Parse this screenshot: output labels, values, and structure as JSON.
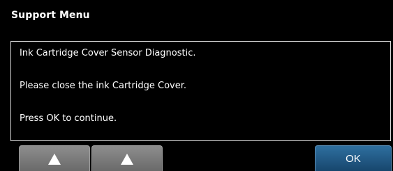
{
  "menu": {
    "title": "Support Menu"
  },
  "message": {
    "lines": [
      "Ink Cartridge Cover Sensor Diagnostic.",
      "Please close the ink Cartridge Cover.",
      "Press OK to continue."
    ]
  },
  "buttons": {
    "up_1_icon": "up-triangle-icon",
    "up_2_icon": "up-triangle-icon",
    "ok_label": "OK"
  },
  "colors": {
    "background": "#000000",
    "ok_button": "#1f5a88",
    "arrow_buttons": "#7a7a7a"
  }
}
